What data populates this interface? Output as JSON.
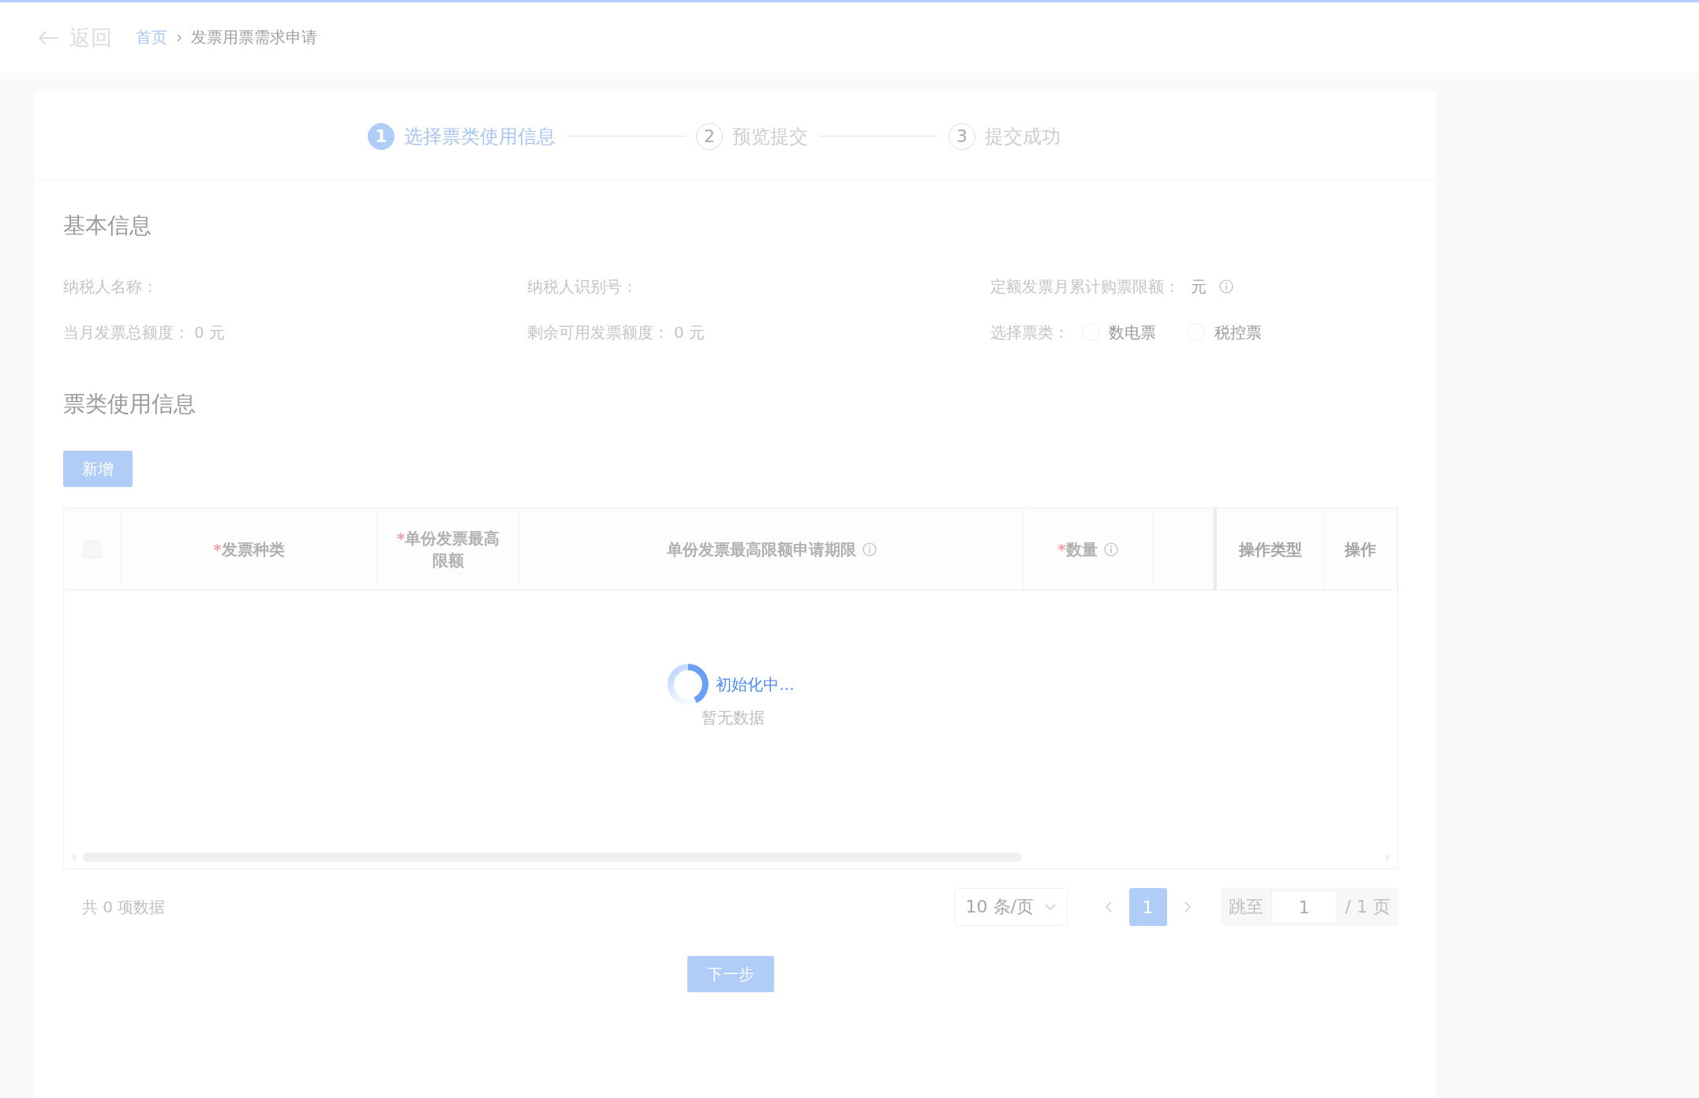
{
  "header": {
    "back": {
      "label": "返回"
    },
    "breadcrumb": [
      {
        "label": "首页",
        "link": true
      },
      {
        "label": "发票用票需求申请",
        "link": false
      }
    ]
  },
  "steps": [
    {
      "number": "1",
      "label": "选择票类使用信息",
      "selected": true
    },
    {
      "number": "2",
      "label": "预览提交",
      "selected": false
    },
    {
      "number": "3",
      "label": "提交成功",
      "selected": false
    }
  ],
  "basic_info": {
    "title": "基本信息",
    "fields": [
      {
        "kind": "text",
        "label": "纳税人名称："
      },
      {
        "kind": "text",
        "label": "纳税人识别号："
      },
      {
        "kind": "text",
        "label": "定额发票月累计购票限额：",
        "value": "元",
        "info": true
      },
      {
        "kind": "text",
        "label": "当月发票总额度：",
        "value": "0 元"
      },
      {
        "kind": "text",
        "label": "剩余可用发票额度：",
        "value": "0 元"
      },
      {
        "kind": "radio",
        "label": "选择票类：",
        "options": [
          {
            "label": "数电票",
            "checked": false
          },
          {
            "label": "税控票",
            "checked": false
          }
        ]
      }
    ]
  },
  "usage": {
    "title": "票类使用信息",
    "add_button": "新增",
    "table": {
      "select_all": {
        "checked": false
      },
      "columns": [
        {
          "label": "发票种类",
          "mark": "*"
        },
        {
          "label": "单份发票最高限额",
          "mark": "*"
        },
        {
          "label": "单份发票最高限额申请期限",
          "info": true
        },
        {
          "label": "数量",
          "mark": "*",
          "info": true
        },
        {},
        {
          "label": "操作类型",
          "fixed": true
        },
        {
          "label": "操作",
          "fixed": true
        }
      ],
      "loading": "初始化中...",
      "empty": "暂无数据"
    },
    "pagination": {
      "total": "共 0 项数据",
      "page_size": "10 条/页",
      "pages": [
        {
          "label": "1",
          "selected": true
        }
      ],
      "jump_label": "跳至",
      "jump_value": "1",
      "page_count": "/ 1 页"
    }
  },
  "next_button": "下一步"
}
